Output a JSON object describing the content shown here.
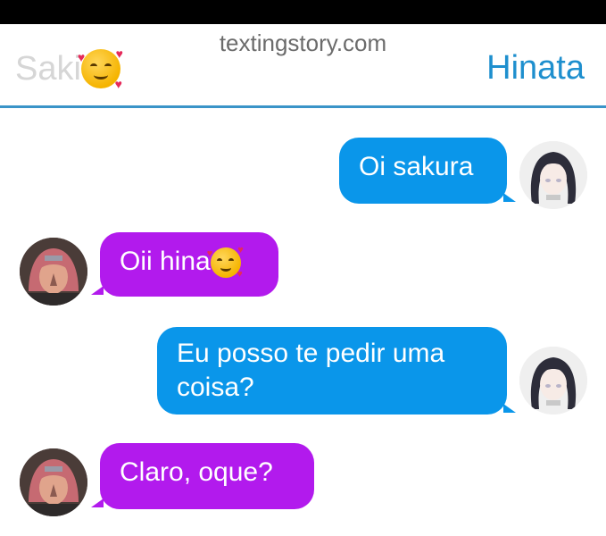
{
  "app": {
    "watermark": "textingstory.com",
    "left_contact": "Saki",
    "left_contact_emoji": "smiling-face-with-hearts",
    "right_contact": "Hinata"
  },
  "colors": {
    "header_accent": "#1e8fce",
    "blue_bubble": "#0a96ea",
    "purple_bubble": "#b21aed"
  },
  "messages": [
    {
      "sender": "Hinata",
      "side": "right",
      "text": "Oi sakura"
    },
    {
      "sender": "Saki",
      "side": "left",
      "text": "Oii hina",
      "emoji": "smiling-face-with-hearts"
    },
    {
      "sender": "Hinata",
      "side": "right",
      "text": "Eu posso te pedir uma coisa?"
    },
    {
      "sender": "Saki",
      "side": "left",
      "text": "Claro, oque?"
    }
  ]
}
